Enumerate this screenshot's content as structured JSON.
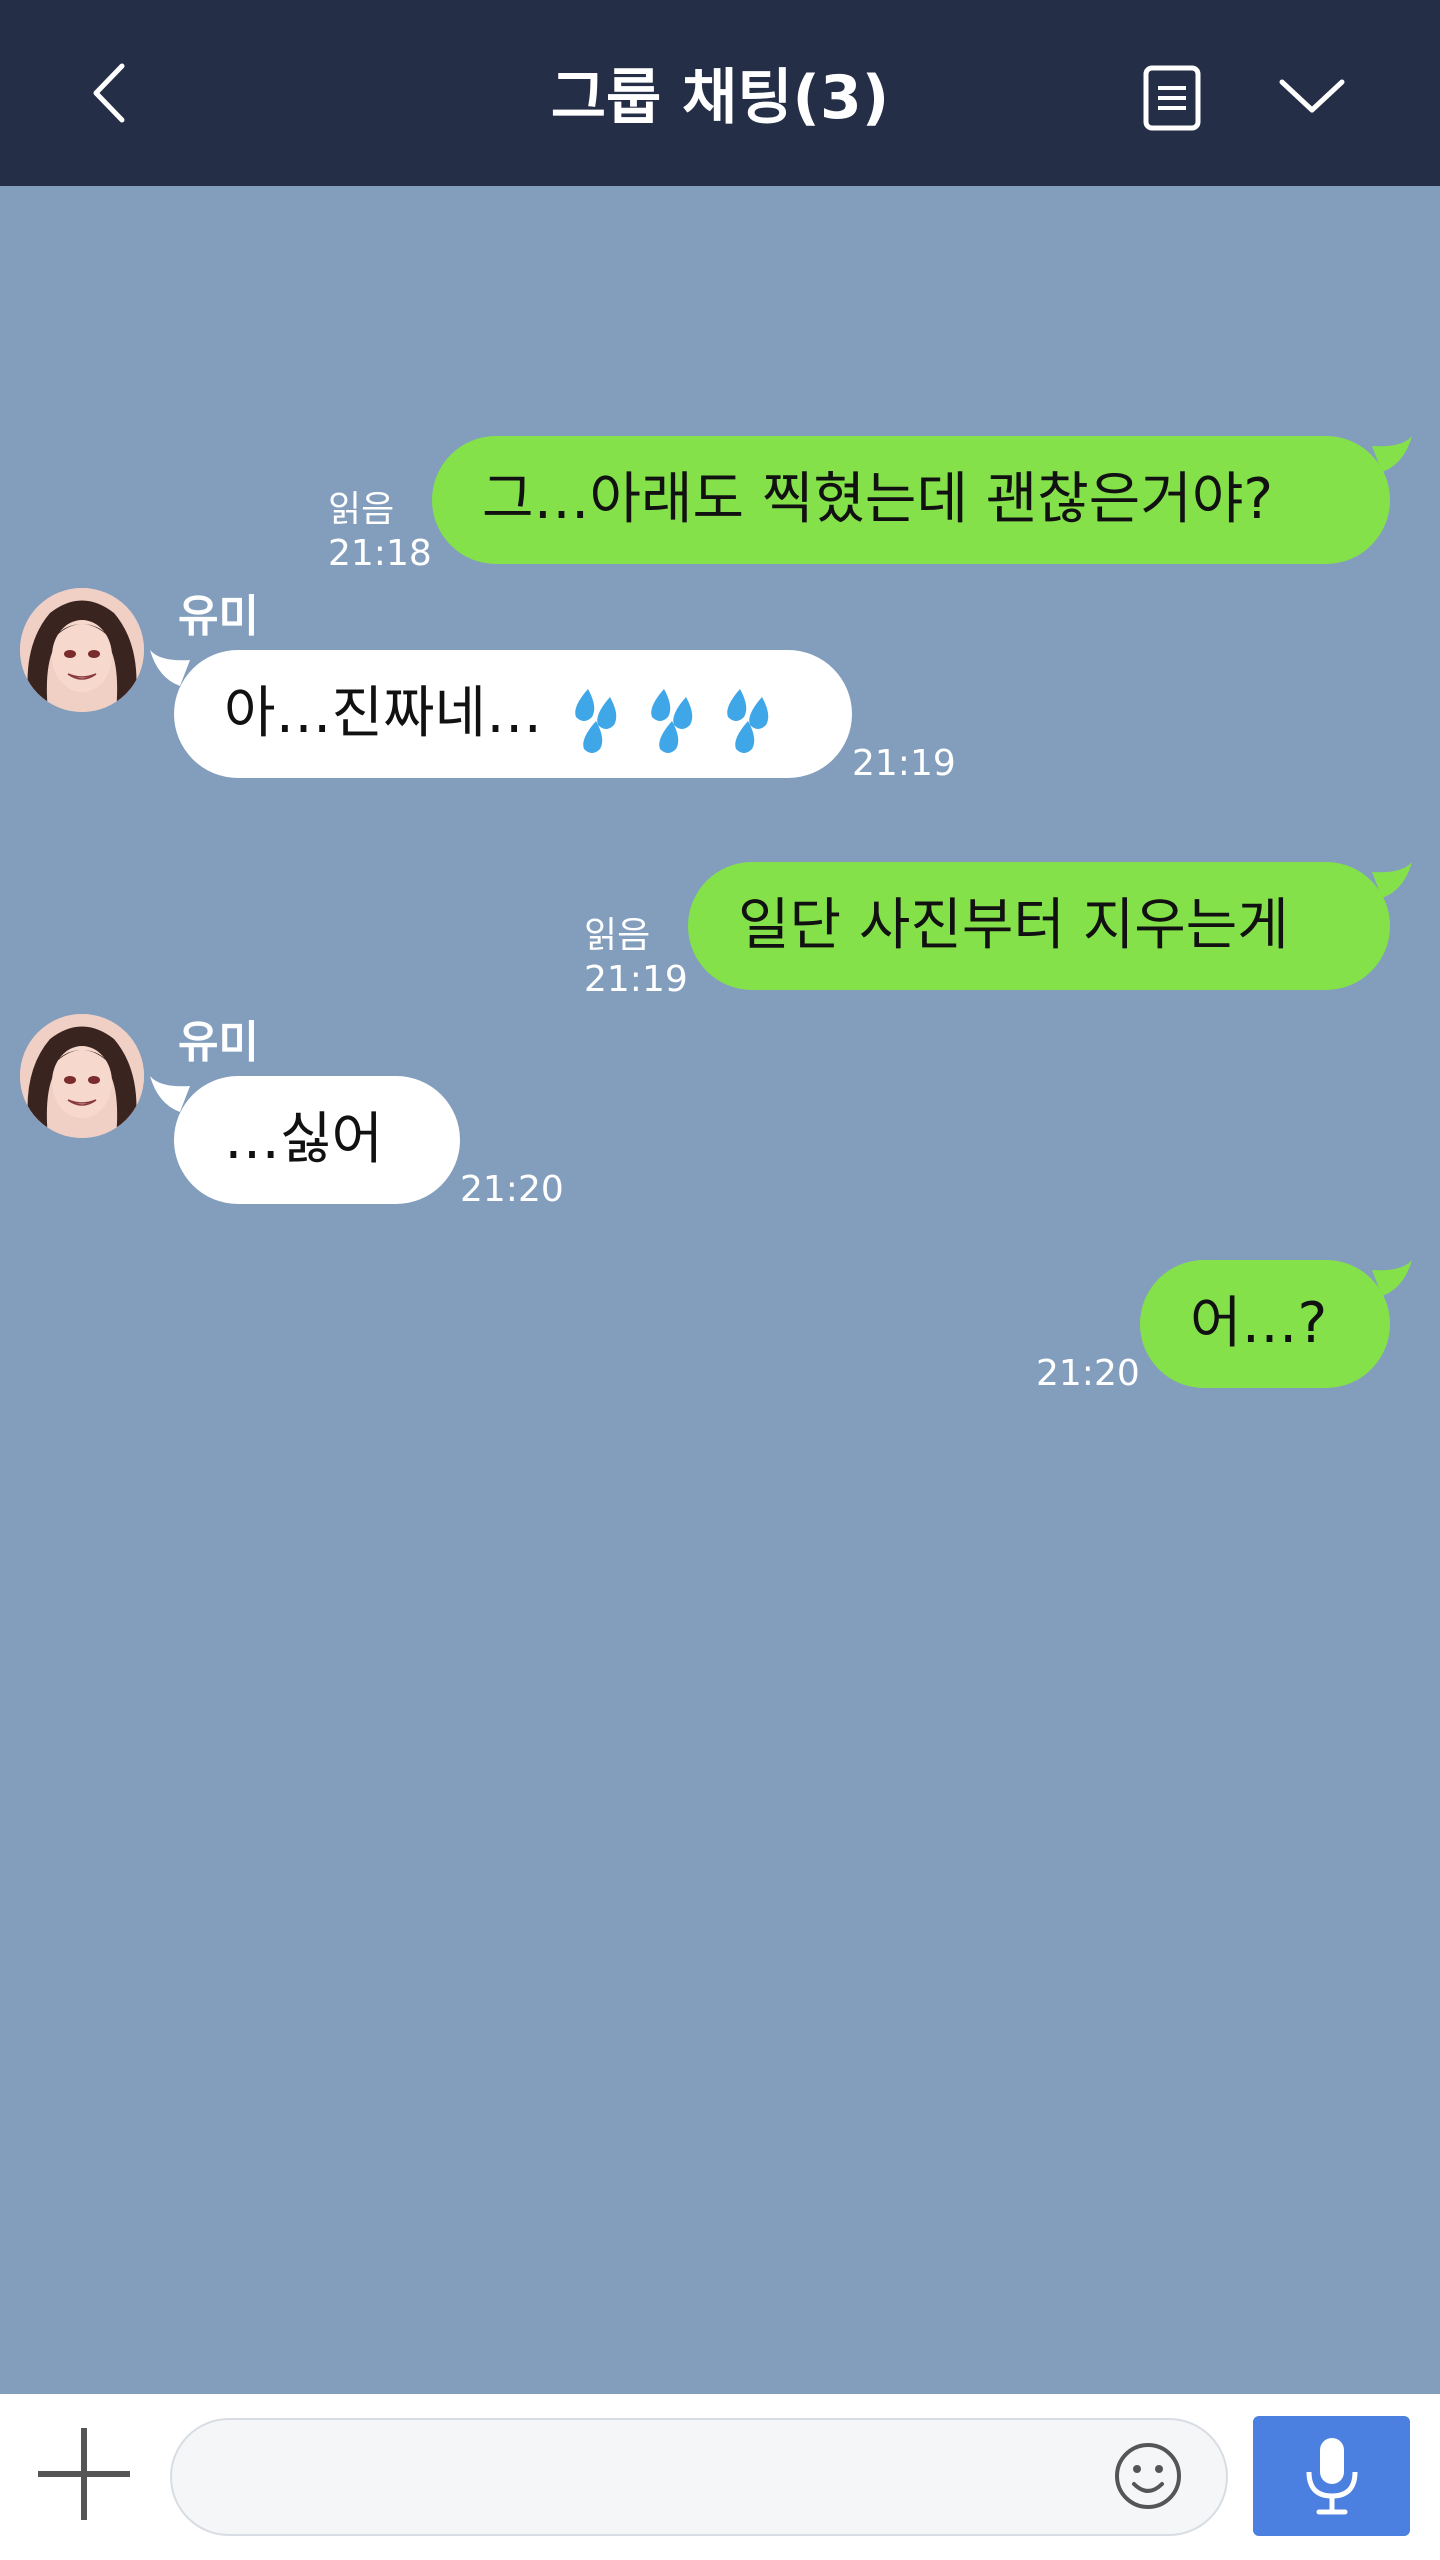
{
  "header": {
    "title": "그룹 채팅(3)",
    "back_icon": "chevron-left-icon",
    "notes_icon": "notes-icon",
    "menu_icon": "chevron-down-icon"
  },
  "messages": [
    {
      "direction": "out",
      "text": "그…아래도 찍혔는데 괜찮은거야?",
      "read": "읽음",
      "time": "21:18"
    },
    {
      "direction": "in",
      "sender": "유미",
      "text": "아…진짜네…",
      "emoji": "sweat-drops",
      "time": "21:19"
    },
    {
      "direction": "out",
      "text": "일단 사진부터 지우는게",
      "read": "읽음",
      "time": "21:19"
    },
    {
      "direction": "in",
      "sender": "유미",
      "text": "…싫어",
      "time": "21:20"
    },
    {
      "direction": "out",
      "text": "어…?",
      "time": "21:20"
    }
  ],
  "input": {
    "placeholder": "",
    "value": ""
  },
  "colors": {
    "header_bg": "#252e47",
    "chat_bg": "#839ebd",
    "outgoing_bubble": "#84e14a",
    "incoming_bubble": "#ffffff",
    "mic_button": "#4b7fe0"
  }
}
